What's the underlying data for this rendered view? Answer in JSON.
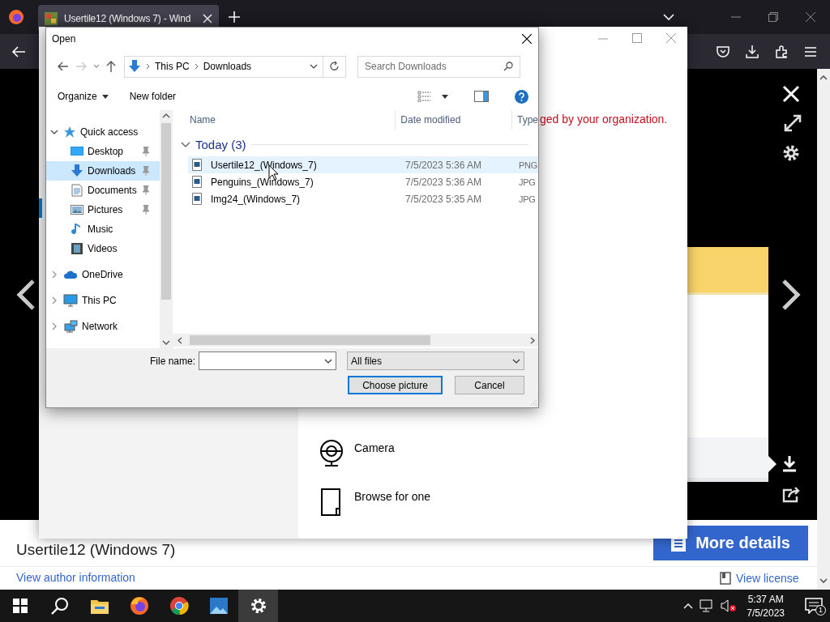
{
  "browser": {
    "tab": {
      "title": "Usertile12 (Windows 7) - Wind"
    }
  },
  "page": {
    "title": "Usertile12 (Windows 7)",
    "more_details": "More details",
    "author_link": "View author information",
    "license_link": "View license"
  },
  "settings_window": {
    "notice": "ged by your organization.",
    "options": [
      {
        "kind": "camera",
        "label": "Camera"
      },
      {
        "kind": "browse",
        "label": "Browse for one"
      }
    ]
  },
  "dialog": {
    "title": "Open",
    "breadcrumb": [
      "This PC",
      "Downloads"
    ],
    "search": {
      "placeholder": "Search Downloads"
    },
    "organize": "Organize",
    "new_folder": "New folder",
    "nav_tree": [
      {
        "kind": "quick-access",
        "label": "Quick access",
        "expanded": true,
        "selected": false,
        "children": [
          {
            "kind": "desktop",
            "label": "Desktop",
            "pinned": true,
            "selected": false
          },
          {
            "kind": "downloads",
            "label": "Downloads",
            "pinned": true,
            "selected": true
          },
          {
            "kind": "documents",
            "label": "Documents",
            "pinned": true,
            "selected": false
          },
          {
            "kind": "pictures",
            "label": "Pictures",
            "pinned": true,
            "selected": false
          },
          {
            "kind": "music",
            "label": "Music",
            "pinned": false,
            "selected": false
          },
          {
            "kind": "videos",
            "label": "Videos",
            "pinned": false,
            "selected": false
          }
        ]
      },
      {
        "kind": "onedrive",
        "label": "OneDrive",
        "expanded": false,
        "selected": false
      },
      {
        "kind": "this-pc",
        "label": "This PC",
        "expanded": false,
        "selected": false
      },
      {
        "kind": "network",
        "label": "Network",
        "expanded": false,
        "selected": false
      }
    ],
    "columns": [
      "Name",
      "Date modified",
      "Type"
    ],
    "group": "Today (3)",
    "files": [
      {
        "name": "Usertile12_(Windows_7)",
        "date": "7/5/2023 5:36 AM",
        "type": "PNG",
        "selected": true
      },
      {
        "name": "Penguins_(Windows_7)",
        "date": "7/5/2023 5:36 AM",
        "type": "JPG",
        "selected": false
      },
      {
        "name": "Img24_(Windows_7)",
        "date": "7/5/2023 5:35 AM",
        "type": "JPG",
        "selected": false
      }
    ],
    "file_name_label": "File name:",
    "filter": "All files",
    "buttons": [
      "Choose picture",
      "Cancel"
    ]
  },
  "taskbar": {
    "apps": [
      {
        "kind": "explorer",
        "selected": false
      },
      {
        "kind": "firefox",
        "selected": false
      },
      {
        "kind": "chrome",
        "selected": false
      },
      {
        "kind": "photos",
        "selected": false
      },
      {
        "kind": "settings",
        "selected": true
      }
    ],
    "time": "5:37 AM",
    "date": "7/5/2023",
    "notifications": "1"
  }
}
